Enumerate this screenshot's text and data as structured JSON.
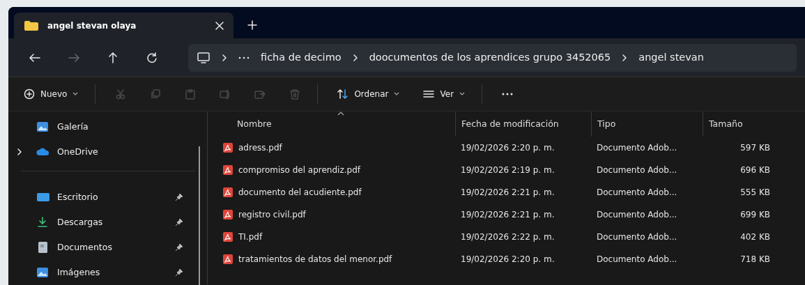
{
  "tab": {
    "title": "angel stevan olaya",
    "selected": true
  },
  "nav_buttons": [
    {
      "kind": "back",
      "disabled": false
    },
    {
      "kind": "forward",
      "disabled": true
    },
    {
      "kind": "up",
      "disabled": false
    },
    {
      "kind": "refresh",
      "disabled": false
    }
  ],
  "breadcrumb": [
    "ficha de decimo",
    "doocumentos de los aprendices grupo 3452065",
    "angel stevan"
  ],
  "toolbar": [
    {
      "kind": "new",
      "label": "Nuevo",
      "disabled": false,
      "dropdown": true
    },
    {
      "kind": "cut",
      "disabled": true
    },
    {
      "kind": "copy",
      "disabled": true
    },
    {
      "kind": "paste",
      "disabled": true
    },
    {
      "kind": "rename",
      "disabled": true
    },
    {
      "kind": "share",
      "disabled": true
    },
    {
      "kind": "delete",
      "disabled": true
    },
    {
      "kind": "sort",
      "label": "Ordenar",
      "disabled": false,
      "dropdown": true
    },
    {
      "kind": "view",
      "label": "Ver",
      "disabled": false,
      "dropdown": true
    },
    {
      "kind": "more",
      "disabled": false
    }
  ],
  "sidebar": {
    "items": [
      {
        "kind": "gallery",
        "label": "Galería",
        "pinned": false
      },
      {
        "kind": "cloud",
        "label": "OneDrive",
        "pinned": false,
        "expanded": false,
        "divider_after": true
      },
      {
        "kind": "desktop",
        "label": "Escritorio",
        "pinned": true
      },
      {
        "kind": "download",
        "label": "Descargas",
        "pinned": true
      },
      {
        "kind": "documents",
        "label": "Documentos",
        "pinned": true
      },
      {
        "kind": "pictures",
        "label": "Imágenes",
        "pinned": true
      }
    ]
  },
  "table": {
    "columns": [
      {
        "label": "Nombre",
        "sorted": true
      },
      {
        "label": "Fecha de modificación",
        "sorted": false
      },
      {
        "label": "Tipo",
        "sorted": false
      },
      {
        "label": "Tamaño",
        "sorted": false
      }
    ],
    "rows": [
      {
        "name": "adress.pdf",
        "modified": "19/02/2026 2:20 p. m.",
        "type": "Documento Adob...",
        "size": "597 KB"
      },
      {
        "name": "compromiso del aprendiz.pdf",
        "modified": "19/02/2026 2:19 p. m.",
        "type": "Documento Adob...",
        "size": "696 KB"
      },
      {
        "name": "documento del acudiente.pdf",
        "modified": "19/02/2026 2:21 p. m.",
        "type": "Documento Adob...",
        "size": "555 KB"
      },
      {
        "name": "registro civil.pdf",
        "modified": "19/02/2026 2:21 p. m.",
        "type": "Documento Adob...",
        "size": "699 KB"
      },
      {
        "name": "TI.pdf",
        "modified": "19/02/2026 2:22 p. m.",
        "type": "Documento Adob...",
        "size": "402 KB"
      },
      {
        "name": "tratamientos de datos del menor.pdf",
        "modified": "19/02/2026 2:20 p. m.",
        "type": "Documento Adob...",
        "size": "718 KB"
      }
    ]
  }
}
